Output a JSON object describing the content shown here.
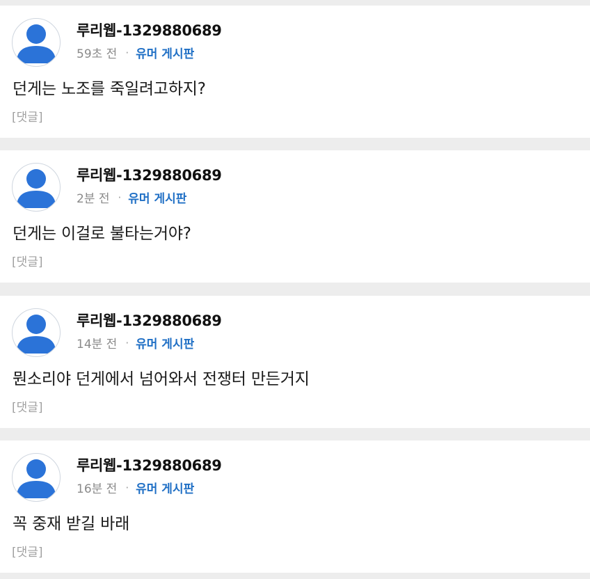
{
  "comments": [
    {
      "author": "루리웹-1329880689",
      "time": "59초 전",
      "separator": "·",
      "board": "유머 게시판",
      "text": "던게는 노조를 죽일려고하지?",
      "reply_label": "[댓글]",
      "avatar_icon": "default-user-icon"
    },
    {
      "author": "루리웹-1329880689",
      "time": "2분 전",
      "separator": "·",
      "board": "유머 게시판",
      "text": "던게는 이걸로 불타는거야?",
      "reply_label": "[댓글]",
      "avatar_icon": "default-user-icon"
    },
    {
      "author": "루리웹-1329880689",
      "time": "14분 전",
      "separator": "·",
      "board": "유머 게시판",
      "text": "뭔소리야 던게에서 넘어와서 전쟁터 만든거지",
      "reply_label": "[댓글]",
      "avatar_icon": "default-user-icon"
    },
    {
      "author": "루리웹-1329880689",
      "time": "16분 전",
      "separator": "·",
      "board": "유머 게시판",
      "text": "꼭 중재 받길 바래",
      "reply_label": "[댓글]",
      "avatar_icon": "default-user-icon"
    }
  ],
  "colors": {
    "background": "#ededed",
    "card": "#ffffff",
    "avatar": "#2b73d8",
    "board_link": "#1f6fc5",
    "muted": "#8a8a8a"
  }
}
